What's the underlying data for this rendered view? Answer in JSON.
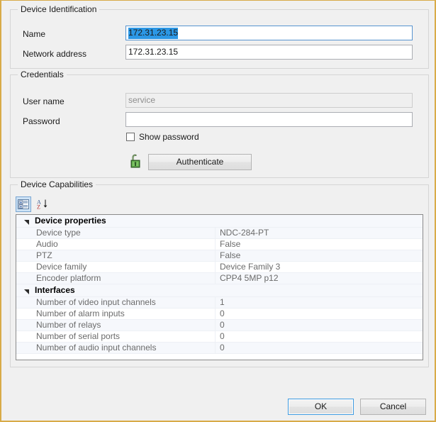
{
  "window": {
    "border_color": "#d8ab48",
    "background": "#f0f0f0"
  },
  "device_identification": {
    "group_title": "Device Identification",
    "name_label": "Name",
    "name_value": "172.31.23.15",
    "name_selected": true,
    "network_address_label": "Network address",
    "network_address_value": "172.31.23.15"
  },
  "credentials": {
    "group_title": "Credentials",
    "user_name_label": "User name",
    "user_name_value": "service",
    "user_name_disabled": true,
    "password_label": "Password",
    "password_value": "",
    "show_password_label": "Show password",
    "show_password_checked": false,
    "authenticate_label": "Authenticate",
    "unlock_icon": "unlock-icon"
  },
  "device_capabilities": {
    "group_title": "Device Capabilities",
    "toolbar": {
      "categorized_icon": "categorized-view-icon",
      "categorized_active": true,
      "sort_icon": "alphabetical-sort-icon",
      "sort_active": false
    },
    "rows": [
      {
        "type": "category",
        "name": "Device properties",
        "value": ""
      },
      {
        "type": "property",
        "name": "Device type",
        "value": "NDC-284-PT"
      },
      {
        "type": "property",
        "name": "Audio",
        "value": "False"
      },
      {
        "type": "property",
        "name": "PTZ",
        "value": "False"
      },
      {
        "type": "property",
        "name": "Device family",
        "value": "Device Family 3"
      },
      {
        "type": "property",
        "name": "Encoder platform",
        "value": "CPP4 5MP p12"
      },
      {
        "type": "category",
        "name": "Interfaces",
        "value": ""
      },
      {
        "type": "property",
        "name": "Number of video input channels",
        "value": "1"
      },
      {
        "type": "property",
        "name": "Number of alarm inputs",
        "value": "0"
      },
      {
        "type": "property",
        "name": "Number of relays",
        "value": "0"
      },
      {
        "type": "property",
        "name": "Number of serial ports",
        "value": "0"
      },
      {
        "type": "property",
        "name": "Number of audio input channels",
        "value": "0"
      }
    ]
  },
  "footer": {
    "ok_label": "OK",
    "cancel_label": "Cancel",
    "ok_is_default": true
  }
}
